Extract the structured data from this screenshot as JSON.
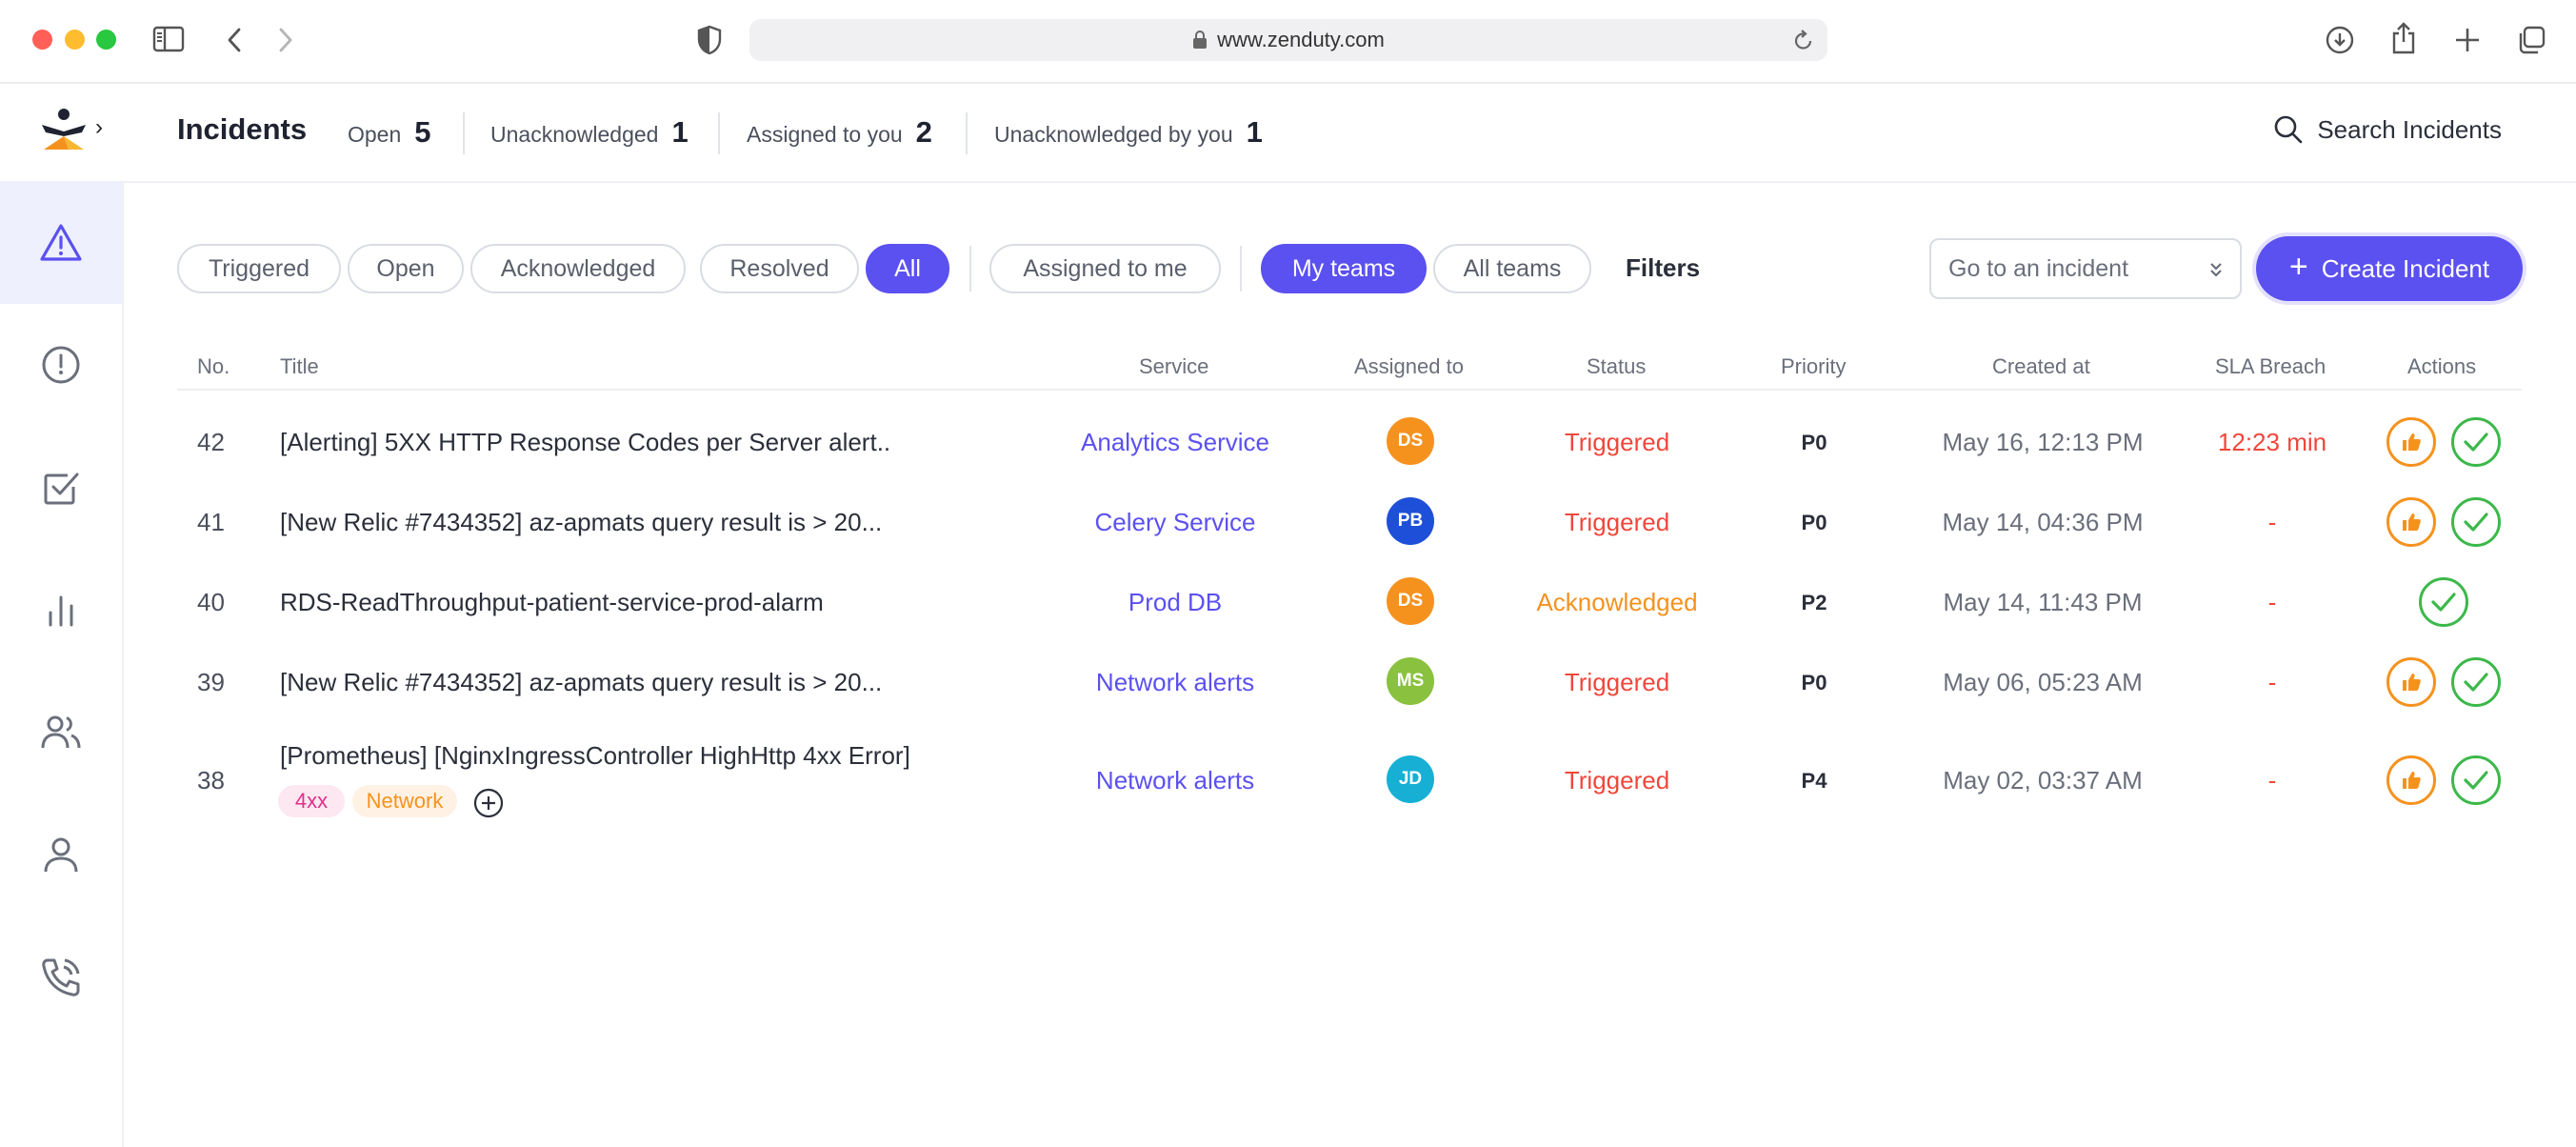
{
  "browser": {
    "url": "www.zenduty.com"
  },
  "header": {
    "title": "Incidents",
    "stats": [
      {
        "label": "Open",
        "count": "5"
      },
      {
        "label": "Unacknowledged",
        "count": "1"
      },
      {
        "label": "Assigned to you",
        "count": "2"
      },
      {
        "label": "Unacknowledged by you",
        "count": "1"
      }
    ],
    "search_label": "Search Incidents"
  },
  "sidebar": {
    "items": [
      {
        "icon": "warning-triangle-icon",
        "active": true
      },
      {
        "icon": "alert-circle-icon",
        "active": false
      },
      {
        "icon": "checkbox-icon",
        "active": false
      },
      {
        "icon": "bar-chart-icon",
        "active": false
      },
      {
        "icon": "users-icon",
        "active": false
      },
      {
        "icon": "user-icon",
        "active": false
      },
      {
        "icon": "phone-icon",
        "active": false
      }
    ]
  },
  "filters": {
    "status_pills": [
      "Triggered",
      "Open",
      "Acknowledged",
      "Resolved",
      "All"
    ],
    "status_selected": "All",
    "assigned_pill": "Assigned to me",
    "team_pills": [
      "My teams",
      "All teams"
    ],
    "team_selected": "My teams",
    "filters_label": "Filters",
    "goto_placeholder": "Go to an incident",
    "create_label": "Create Incident"
  },
  "table": {
    "columns": [
      "No.",
      "Title",
      "Service",
      "Assigned to",
      "Status",
      "Priority",
      "Created at",
      "SLA Breach",
      "Actions"
    ],
    "rows": [
      {
        "no": "42",
        "title": "[Alerting] 5XX HTTP Response Codes per Server alert..",
        "service": "Analytics Service",
        "assignee": "DS",
        "assignee_color": "#f5921e",
        "status": "Triggered",
        "priority": "P0",
        "created": "May 16, 12:13 PM",
        "sla": "12:23 min",
        "actions": [
          "acknowledge",
          "resolve"
        ]
      },
      {
        "no": "41",
        "title": "[New Relic #7434352] az-apmats query result is > 20...",
        "service": "Celery Service",
        "assignee": "PB",
        "assignee_color": "#1e4fd8",
        "status": "Triggered",
        "priority": "P0",
        "created": "May 14, 04:36 PM",
        "sla": "-",
        "actions": [
          "acknowledge",
          "resolve"
        ]
      },
      {
        "no": "40",
        "title": "RDS-ReadThroughput-patient-service-prod-alarm",
        "service": "Prod DB",
        "assignee": "DS",
        "assignee_color": "#f5921e",
        "status": "Acknowledged",
        "priority": "P2",
        "created": "May 14, 11:43 PM",
        "sla": "-",
        "actions": [
          "resolve"
        ]
      },
      {
        "no": "39",
        "title": "[New Relic #7434352] az-apmats query result is > 20...",
        "service": "Network alerts",
        "assignee": "MS",
        "assignee_color": "#8ac13f",
        "status": "Triggered",
        "priority": "P0",
        "created": "May 06, 05:23 AM",
        "sla": "-",
        "actions": [
          "acknowledge",
          "resolve"
        ]
      },
      {
        "no": "38",
        "title": "[Prometheus] [NginxIngressController HighHttp 4xx Error]",
        "service": "Network alerts",
        "assignee": "JD",
        "assignee_color": "#17b0d4",
        "status": "Triggered",
        "priority": "P4",
        "created": "May 02, 03:37 AM",
        "sla": "-",
        "tags": [
          "4xx",
          "Network"
        ],
        "actions": [
          "acknowledge",
          "resolve"
        ]
      }
    ]
  },
  "colors": {
    "accent": "#5b50f0",
    "triggered": "#f0473c",
    "acknowledged": "#f5921e",
    "resolve": "#3cb84a"
  }
}
